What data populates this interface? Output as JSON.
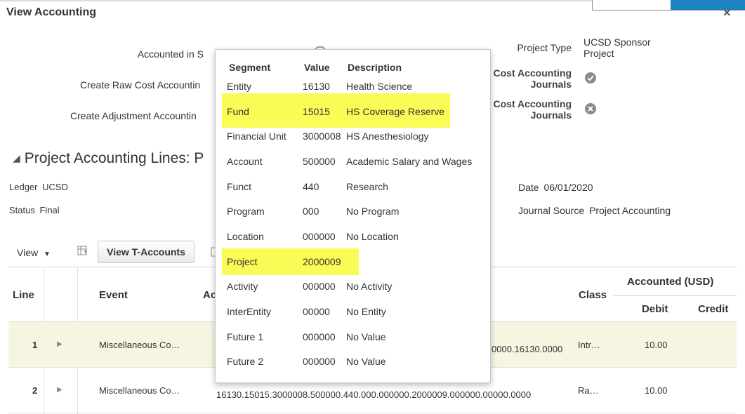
{
  "dialog": {
    "title": "View Accounting",
    "close_label": "×"
  },
  "form": {
    "accounted_in_label": "Accounted in S",
    "create_raw_cost_label": "Create Raw Cost Accountin",
    "create_adjustment_label": "Create Adjustment Accountin",
    "project_type_label": "Project Type",
    "project_type_value": "UCSD Sponsor Project",
    "cost_journals_label_1": "Cost Accounting Journals",
    "cost_journals_label_2": "Cost Accounting Journals",
    "cost_journals_icon_1": "check-icon",
    "cost_journals_icon_2": "x-icon"
  },
  "section": {
    "title": "Project Accounting Lines: P",
    "ledger_label": "Ledger",
    "ledger_value": "UCSD",
    "status_label": "Status",
    "status_value": "Final",
    "date_label": "Date",
    "date_value": "06/01/2020",
    "journal_source_label": "Journal Source",
    "journal_source_value": "Project Accounting"
  },
  "toolbar": {
    "view_menu_label": "View",
    "view_t_accounts_label": "View T-Accounts"
  },
  "table": {
    "headers": {
      "line": "Line",
      "event": "Event",
      "account_partial": "Ac",
      "class": "Class",
      "accounted": "Accounted (USD)",
      "debit": "Debit",
      "credit": "Credit"
    },
    "rows": [
      {
        "line": "1",
        "event": "Miscellaneous Co…",
        "account": "0000.16130.0000",
        "class": "Intr…",
        "debit": "10.00",
        "credit": ""
      },
      {
        "line": "2",
        "event": "Miscellaneous Co…",
        "account": "16130.15015.3000008.500000.440.000.000000.2000009.000000.00000.0000",
        "class": "Ra…",
        "debit": "10.00",
        "credit": ""
      }
    ]
  },
  "popup": {
    "headers": {
      "segment": "Segment",
      "value": "Value",
      "description": "Description"
    },
    "highlight_color": "#fbfb58",
    "segments": [
      {
        "segment": "Entity",
        "value": "16130",
        "description": "Health Science"
      },
      {
        "segment": "Fund",
        "value": "15015",
        "description": "HS Coverage Reserve"
      },
      {
        "segment": "Financial Unit",
        "value": "3000008",
        "description": "HS Anesthesiology"
      },
      {
        "segment": "Account",
        "value": "500000",
        "description": "Academic Salary and Wages"
      },
      {
        "segment": "Funct",
        "value": "440",
        "description": "Research"
      },
      {
        "segment": "Program",
        "value": "000",
        "description": "No Program"
      },
      {
        "segment": "Location",
        "value": "000000",
        "description": "No Location"
      },
      {
        "segment": "Project",
        "value": "2000009",
        "description": ""
      },
      {
        "segment": "Activity",
        "value": "000000",
        "description": "No Activity"
      },
      {
        "segment": "InterEntity",
        "value": "00000",
        "description": "No Entity"
      },
      {
        "segment": "Future 1",
        "value": "000000",
        "description": "No Value"
      },
      {
        "segment": "Future 2",
        "value": "000000",
        "description": "No Value"
      }
    ]
  }
}
